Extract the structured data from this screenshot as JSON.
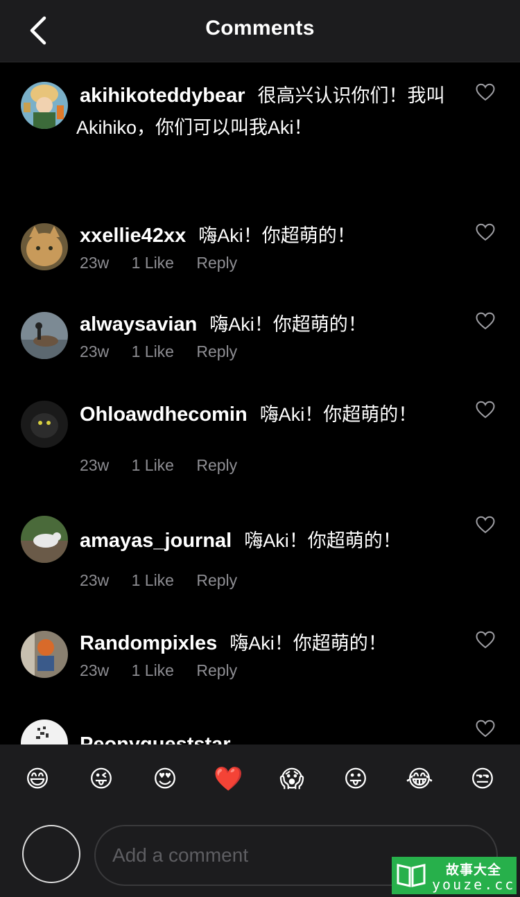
{
  "header": {
    "title": "Comments",
    "back_icon": "chevron-left-icon"
  },
  "caption": {
    "username": "akihikoteddybear",
    "text_line1": "很高兴认识你们！我叫",
    "text_line2": "Akihiko，你们可以叫我Aki！"
  },
  "comments": [
    {
      "username": "xxellie42xx",
      "text": "嗨Aki！你超萌的！",
      "time": "23w",
      "likes": "1 Like",
      "reply": "Reply"
    },
    {
      "username": "alwaysavian",
      "text": "嗨Aki！你超萌的！",
      "time": "23w",
      "likes": "1 Like",
      "reply": "Reply"
    },
    {
      "username": "Ohloawdhecomin",
      "text": "嗨Aki！你超萌的！",
      "time": "23w",
      "likes": "1 Like",
      "reply": "Reply"
    },
    {
      "username": "amayas_journal",
      "text": "嗨Aki！你超萌的！",
      "time": "23w",
      "likes": "1 Like",
      "reply": "Reply"
    },
    {
      "username": "Randompixles",
      "text": "嗨Aki！你超萌的！",
      "time": "23w",
      "likes": "1 Like",
      "reply": "Reply"
    },
    {
      "username": "Peonygueststar"
    }
  ],
  "emoji_bar": [
    "😄",
    "😜",
    "😍",
    "❤️",
    "😱",
    "😛",
    "😂",
    "😒"
  ],
  "composer": {
    "placeholder": "Add a comment"
  },
  "watermark": {
    "line1": "故事大全",
    "line2": "youze.cc"
  },
  "colors": {
    "background": "#000000",
    "bar": "#1c1c1e",
    "meta": "#8e8e93",
    "watermark": "#27b04b"
  }
}
